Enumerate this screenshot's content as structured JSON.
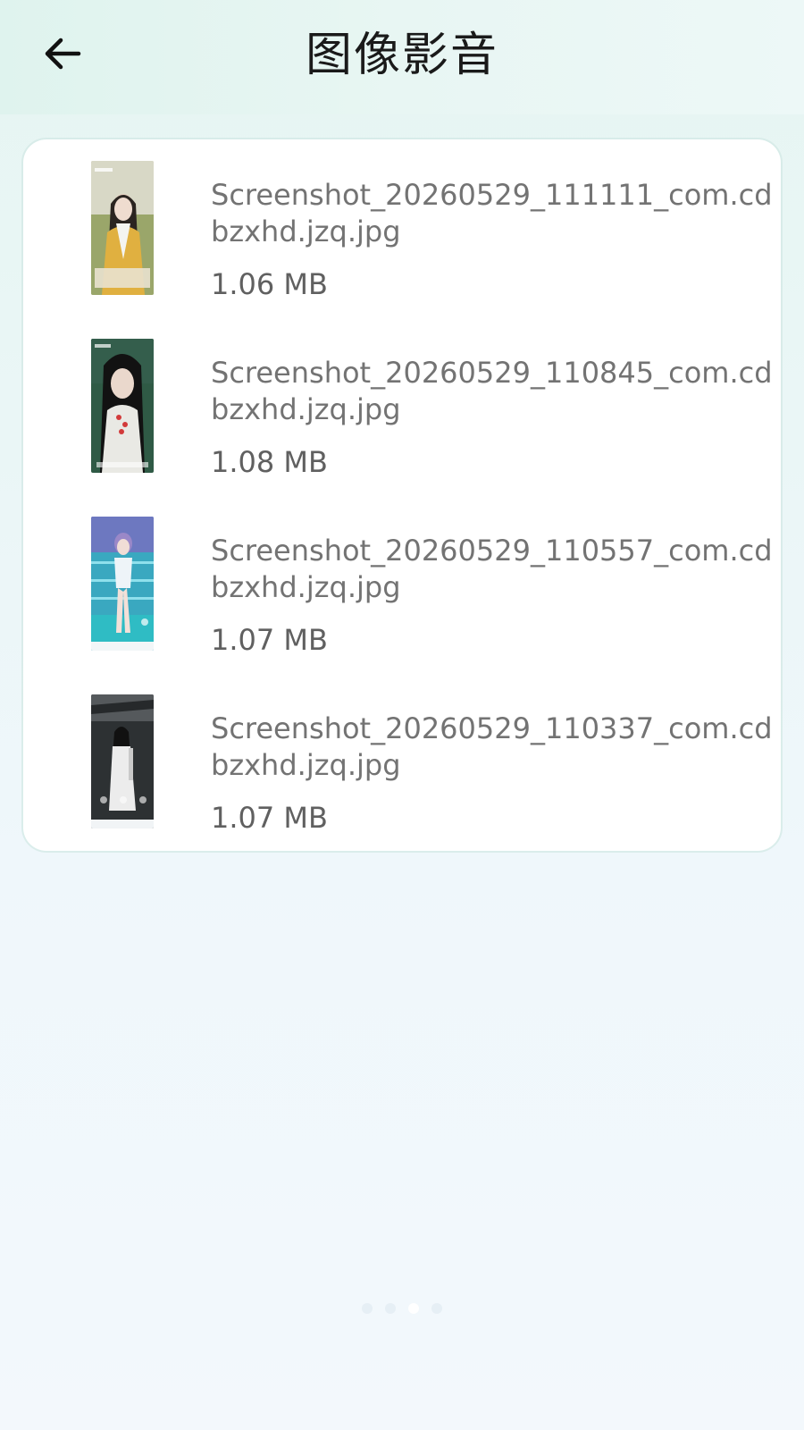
{
  "header": {
    "title": "图像影音",
    "back_icon": "arrow-left-icon"
  },
  "files": [
    {
      "name": "Screenshot_20260529_111111_com.cdbzxhd.jzq.jpg",
      "size": "1.06 MB",
      "thumb_icon": "image-thumbnail"
    },
    {
      "name": "Screenshot_20260529_110845_com.cdbzxhd.jzq.jpg",
      "size": "1.08 MB",
      "thumb_icon": "image-thumbnail"
    },
    {
      "name": "Screenshot_20260529_110557_com.cdbzxhd.jzq.jpg",
      "size": "1.07 MB",
      "thumb_icon": "image-thumbnail"
    },
    {
      "name": "Screenshot_20260529_110337_com.cdbzxhd.jzq.jpg",
      "size": "1.07 MB",
      "thumb_icon": "image-thumbnail"
    }
  ],
  "pager": {
    "count": 4,
    "active_index": 2
  },
  "colors": {
    "title": "#1a1a1a",
    "file_name": "#737373",
    "file_size": "#606060",
    "card_bg": "#ffffff"
  }
}
